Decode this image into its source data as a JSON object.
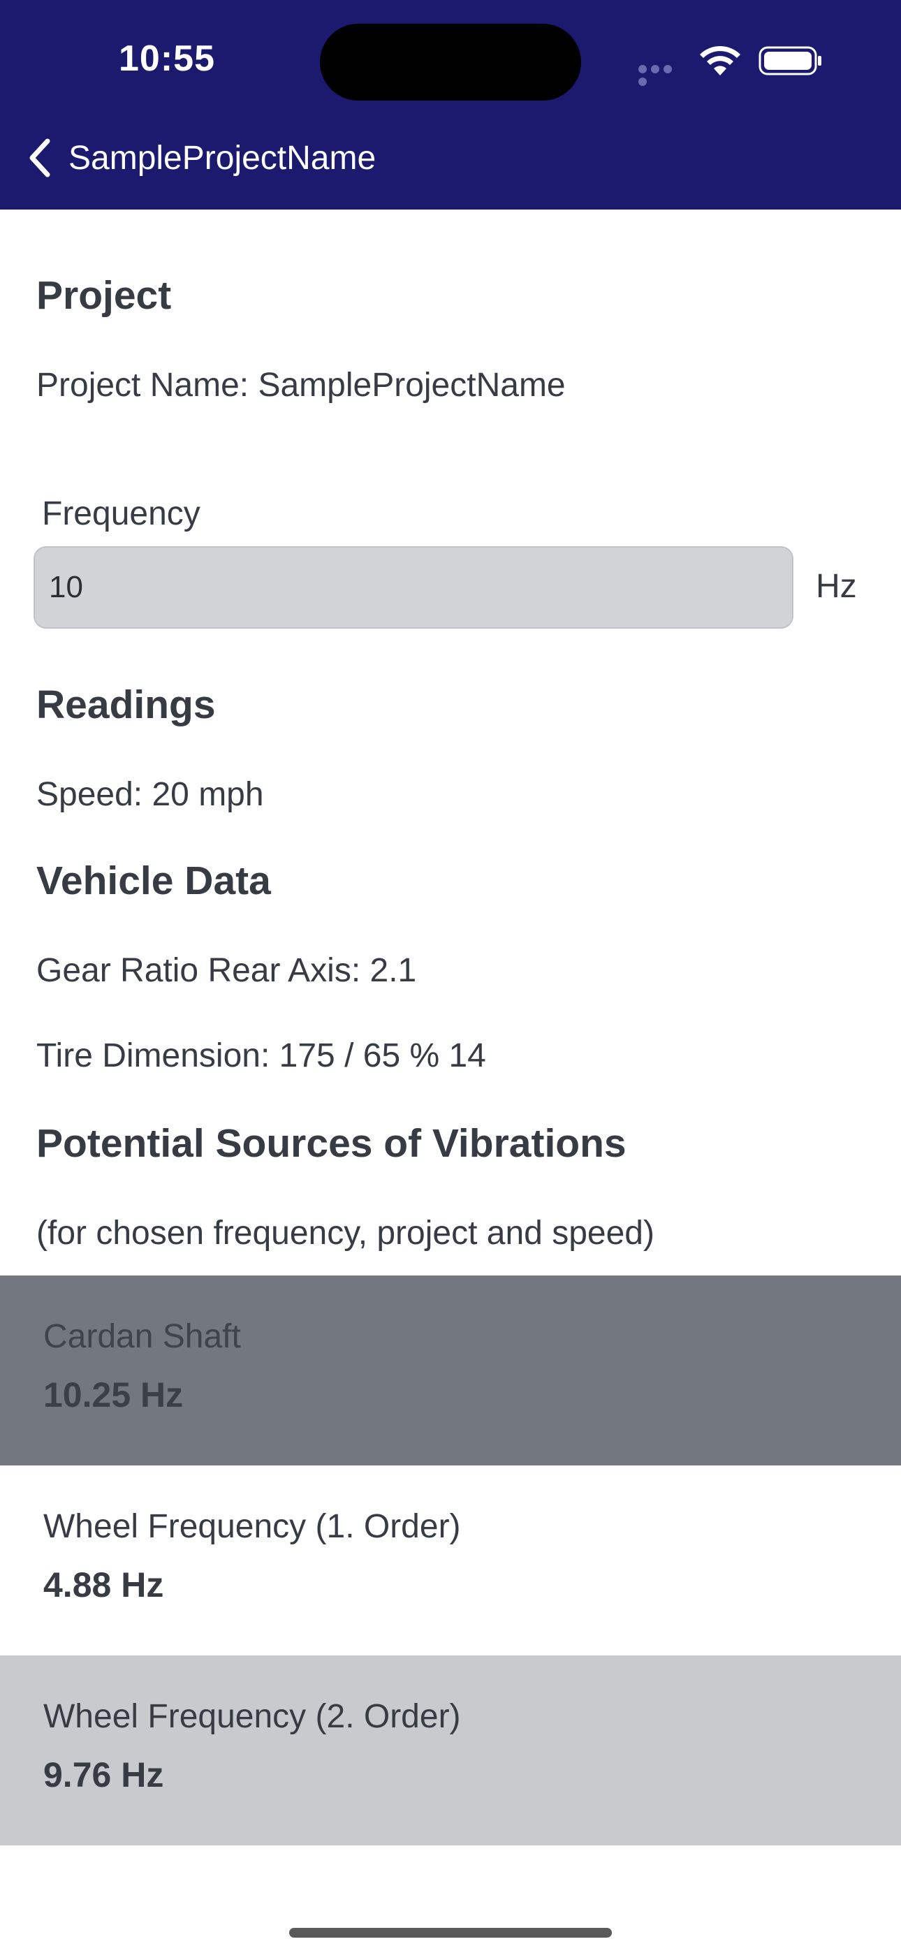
{
  "status_bar": {
    "time": "10:55"
  },
  "nav": {
    "back_label": "SampleProjectName"
  },
  "project": {
    "title": "Project",
    "name_line": "Project Name: SampleProjectName"
  },
  "frequency": {
    "label": "Frequency",
    "value": "10",
    "unit": "Hz"
  },
  "readings": {
    "title": "Readings",
    "speed_line": "Speed: 20 mph"
  },
  "vehicle": {
    "title": "Vehicle Data",
    "gear_line": "Gear Ratio Rear Axis: 2.1",
    "tire_line": "Tire Dimension: 175 / 65 % 14"
  },
  "sources": {
    "title": "Potential Sources of Vibrations",
    "subtitle": "(for chosen frequency, project and speed)",
    "items": [
      {
        "name": "Cardan Shaft",
        "value": "10.25 Hz"
      },
      {
        "name": "Wheel Frequency (1. Order)",
        "value": "4.88 Hz"
      },
      {
        "name": "Wheel Frequency (2. Order)",
        "value": "9.76 Hz"
      }
    ]
  },
  "colors": {
    "header_bg": "#1b1a6e",
    "text": "#373b44",
    "selected_row": "#737880",
    "grey_row": "#c9cacd",
    "input_bg": "#d2d3d6"
  }
}
